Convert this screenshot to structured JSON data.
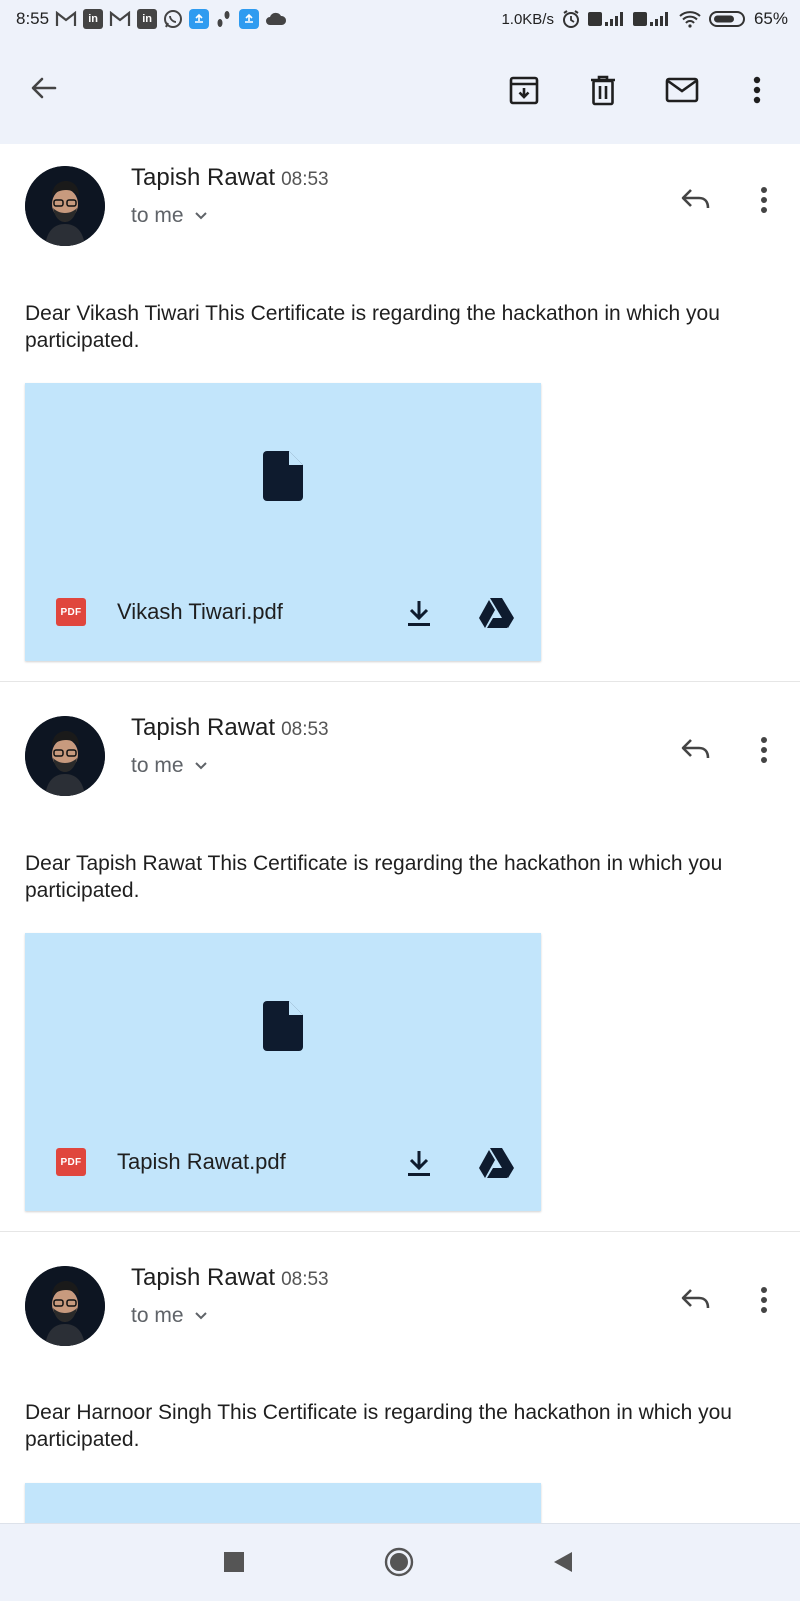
{
  "status_bar": {
    "time": "8:55",
    "speed": "1.0KB/s",
    "battery": "65%",
    "notification_icons": [
      "gmail-icon",
      "linkedin-icon",
      "gmail-icon",
      "linkedin-icon",
      "whatsapp-icon",
      "app-icon",
      "footsteps-icon",
      "app-icon",
      "cloud-icon"
    ]
  },
  "toolbar": {
    "back_icon": "arrow-left-icon",
    "archive_icon": "archive-icon",
    "delete_icon": "trash-icon",
    "mark_unread_icon": "mail-icon",
    "more_icon": "more-vertical-icon"
  },
  "messages": [
    {
      "sender": "Tapish Rawat",
      "time": "08:53",
      "recipient": "to me",
      "body": "Dear Vikash Tiwari This Certificate is regarding the hackathon in which you participated.",
      "attachment": {
        "badge": "PDF",
        "file_name": "Vikash Tiwari.pdf"
      }
    },
    {
      "sender": "Tapish Rawat",
      "time": "08:53",
      "recipient": "to me",
      "body": "Dear Tapish Rawat This Certificate is regarding the hackathon in which you participated.",
      "attachment": {
        "badge": "PDF",
        "file_name": "Tapish Rawat.pdf"
      }
    },
    {
      "sender": "Tapish Rawat",
      "time": "08:53",
      "recipient": "to me",
      "body": "Dear Harnoor Singh This Certificate is regarding the hackathon in which you participated.",
      "attachment": {
        "badge": "",
        "file_name": ""
      }
    }
  ],
  "colors": {
    "attachment_bg": "#c2e5fb",
    "pdf_badge": "#e0463d",
    "bar_bg": "#eef2fa"
  },
  "nav_bar": {
    "icons": [
      "recents-square-icon",
      "home-circle-icon",
      "back-triangle-icon"
    ]
  }
}
